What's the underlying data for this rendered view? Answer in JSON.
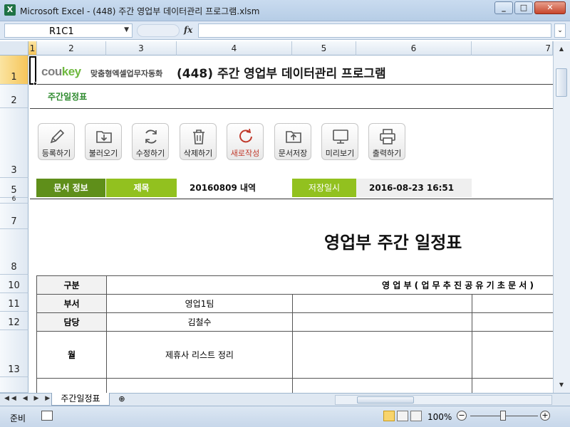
{
  "window": {
    "title": "Microsoft Excel - (448) 주간 영업부 데이터관리 프로그램.xlsm"
  },
  "formula_bar": {
    "name_box": "R1C1",
    "fx": "fx",
    "formula": ""
  },
  "columns": [
    "1",
    "2",
    "3",
    "4",
    "5",
    "6",
    "7"
  ],
  "rows": [
    "1",
    "2",
    "3",
    "5",
    "6",
    "7",
    "8",
    "10",
    "11",
    "12",
    "13"
  ],
  "header": {
    "logo_prefix": "cou",
    "logo_key": "key",
    "logo_tagline": "맞춤형엑셀업무자동화",
    "app_title": "(448) 주간 영업부 데이터관리 프로그램",
    "sheet_title": "주간일정표"
  },
  "toolbar": {
    "buttons": [
      {
        "label": "등록하기",
        "icon": "pencil-icon"
      },
      {
        "label": "불러오기",
        "icon": "folder-download-icon"
      },
      {
        "label": "수정하기",
        "icon": "refresh-icon"
      },
      {
        "label": "삭제하기",
        "icon": "trash-icon"
      },
      {
        "label": "새로작성",
        "icon": "new-refresh-icon"
      },
      {
        "label": "문서저장",
        "icon": "folder-upload-icon"
      },
      {
        "label": "미리보기",
        "icon": "monitor-icon"
      },
      {
        "label": "출력하기",
        "icon": "printer-icon"
      }
    ]
  },
  "doc_info": {
    "label": "문서 정보",
    "title_label": "제목",
    "title_value": "20160809 내역",
    "saved_label": "저장일시",
    "saved_value": "2016-08-23 16:51"
  },
  "schedule": {
    "title": "영업부 주간 일정표",
    "col_header_label": "구분",
    "col_header_value": "영 업 부 ( 업 무 추 진 공 유 기 초 문 서 )",
    "rows": [
      {
        "label": "부서",
        "value": "영업1팀"
      },
      {
        "label": "담당",
        "value": "김철수"
      },
      {
        "label": "월",
        "value": "제휴사 리스트 정리"
      }
    ]
  },
  "sheet_tabs": {
    "active": "주간일정표"
  },
  "status": {
    "ready": "준비",
    "zoom": "100%"
  },
  "colors": {
    "green_dark": "#5f8f1a",
    "green_light": "#92c11f",
    "accent_red": "#c0392b"
  }
}
